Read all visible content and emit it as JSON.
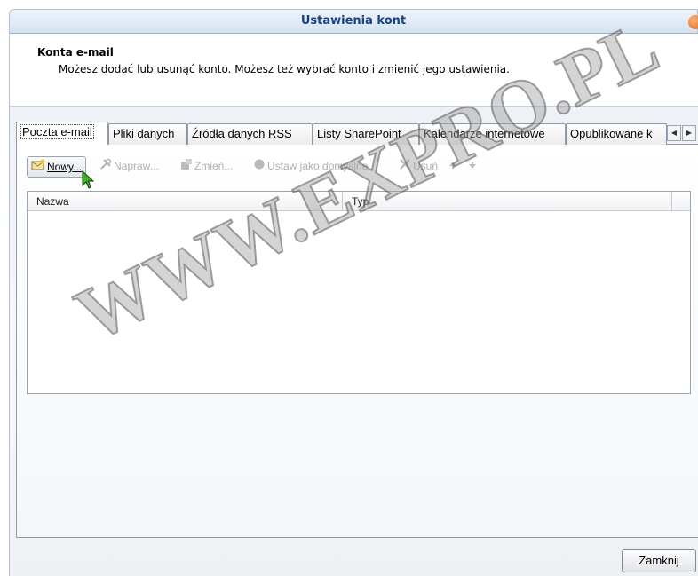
{
  "window": {
    "title": "Ustawienia kont"
  },
  "header": {
    "title": "Konta e-mail",
    "description": "Możesz dodać lub usunąć konto. Możesz też wybrać konto i zmienić jego ustawienia."
  },
  "tabs": [
    {
      "label": "Poczta e-mail",
      "active": true
    },
    {
      "label": "Pliki danych"
    },
    {
      "label": "Źródła danych RSS"
    },
    {
      "label": "Listy SharePoint"
    },
    {
      "label": "Kalendarze internetowe"
    },
    {
      "label": "Opublikowane k"
    }
  ],
  "toolbar": {
    "new_label": "Nowy...",
    "repair_label": "Napraw...",
    "change_label": "Zmień...",
    "default_label": "Ustaw jako domyślne",
    "delete_label": "Usuń"
  },
  "list": {
    "columns": [
      "Nazwa",
      "Typ"
    ]
  },
  "watermark": "WWW.EXPRO.PL",
  "footer": {
    "close_label": "Zamknij"
  },
  "colors": {
    "title_text": "#15428b",
    "accent_close": "#e0641d"
  }
}
